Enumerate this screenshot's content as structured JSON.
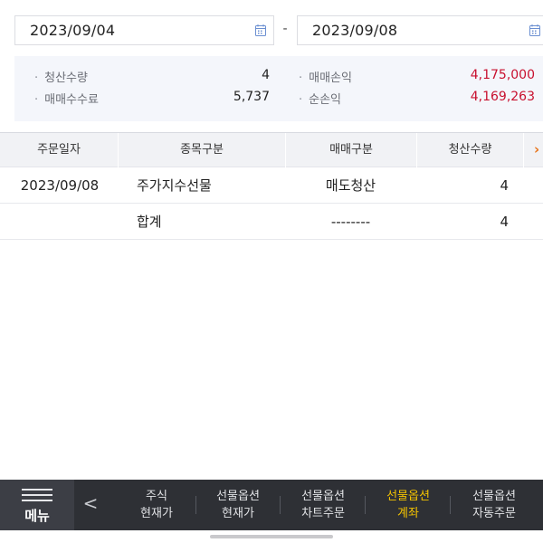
{
  "date_range": {
    "from": "2023/09/04",
    "to": "2023/09/08",
    "separator": "-"
  },
  "summary": {
    "settled_qty_label": "청산수량",
    "settled_qty": "4",
    "trade_fee_label": "매매수수료",
    "trade_fee": "5,737",
    "trade_pnl_label": "매매손익",
    "trade_pnl": "4,175,000",
    "net_pnl_label": "순손익",
    "net_pnl": "4,169,263"
  },
  "table": {
    "headers": [
      "주문일자",
      "종목구분",
      "매매구분",
      "청산수량"
    ],
    "more_arrow": "›",
    "rows": [
      {
        "date": "2023/09/08",
        "item_type": "주가지수선물",
        "trade_type": "매도청산",
        "qty": "4"
      },
      {
        "date": "",
        "item_type": "합계",
        "trade_type": "--------",
        "qty": "4"
      }
    ]
  },
  "bottom_nav": {
    "menu_label": "메뉴",
    "back_glyph": "<",
    "items": [
      {
        "line1": "주식",
        "line2": "현재가",
        "active": false
      },
      {
        "line1": "선물옵션",
        "line2": "현재가",
        "active": false
      },
      {
        "line1": "선물옵션",
        "line2": "차트주문",
        "active": false
      },
      {
        "line1": "선물옵션",
        "line2": "계좌",
        "active": true
      },
      {
        "line1": "선물옵션",
        "line2": "자동주문",
        "active": false
      }
    ]
  },
  "colors": {
    "accent_active": "#f5c400",
    "profit_red": "#c8102e",
    "arrow_orange": "#e8741a",
    "nav_bg": "#2e3035"
  },
  "icons": [
    "calendar-icon",
    "hamburger-icon",
    "chevron-left-icon",
    "chevron-right-icon"
  ]
}
